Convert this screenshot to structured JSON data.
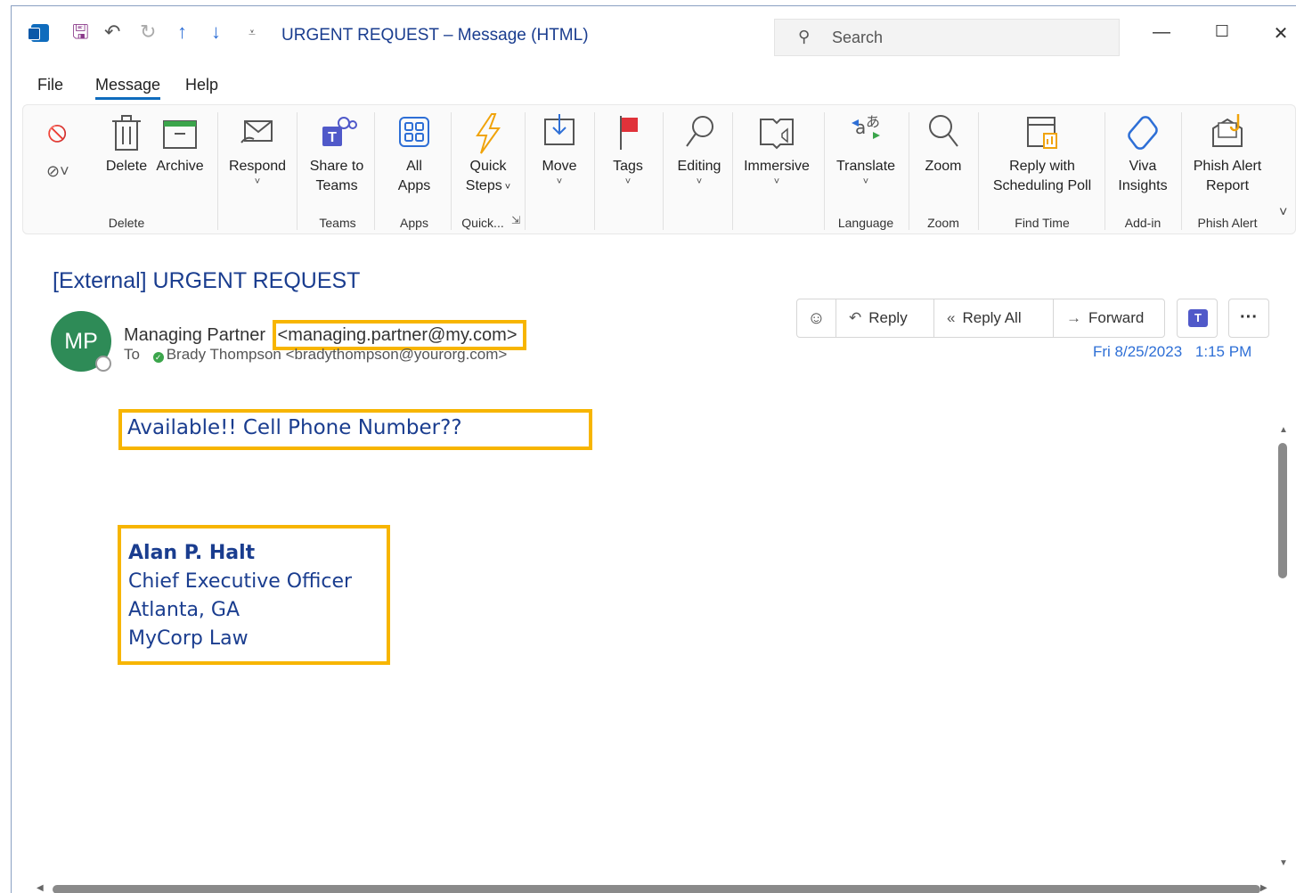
{
  "window": {
    "title": "URGENT REQUEST – Message (HTML)",
    "search_placeholder": "Search"
  },
  "menu": {
    "tabs": [
      "File",
      "Message",
      "Help"
    ],
    "active": "Message"
  },
  "ribbon": {
    "buttons": {
      "delete": "Delete",
      "archive": "Archive",
      "respond": "Respond",
      "share_teams_1": "Share to",
      "share_teams_2": "Teams",
      "all_apps_1": "All",
      "all_apps_2": "Apps",
      "quick_steps_1": "Quick",
      "quick_steps_2": "Steps",
      "move": "Move",
      "tags": "Tags",
      "editing": "Editing",
      "immersive": "Immersive",
      "translate": "Translate",
      "zoom": "Zoom",
      "reply_poll_1": "Reply with",
      "reply_poll_2": "Scheduling Poll",
      "viva_1": "Viva",
      "viva_2": "Insights",
      "phish_1": "Phish Alert",
      "phish_2": "Report"
    },
    "groups": {
      "delete": "Delete",
      "teams": "Teams",
      "apps": "Apps",
      "quick": "Quick...",
      "language": "Language",
      "zoom": "Zoom",
      "find_time": "Find Time",
      "addin": "Add-in",
      "phish": "Phish Alert"
    }
  },
  "message": {
    "subject": "[External] URGENT REQUEST",
    "avatar_initials": "MP",
    "from_name": "Managing Partner",
    "from_address": "<managing.partner@my.com>",
    "to_label": "To",
    "to_recipient": "Brady Thompson <bradythompson@yourorg.com>",
    "date": "Fri 8/25/2023",
    "time": "1:15 PM",
    "actions": {
      "reply": "Reply",
      "reply_all": "Reply All",
      "forward": "Forward",
      "more": "···"
    },
    "body_line": "Available!! Cell Phone Number??",
    "signature": {
      "name": "Alan P. Halt",
      "title": "Chief Executive Officer",
      "location": "Atlanta, GA",
      "company": "MyCorp Law"
    }
  },
  "colors": {
    "accent": "#0f6cbd",
    "subject_text": "#1a3d8f",
    "highlight_box": "#f7b500",
    "avatar_bg": "#2e8b57",
    "date_text": "#2e6fd6"
  }
}
